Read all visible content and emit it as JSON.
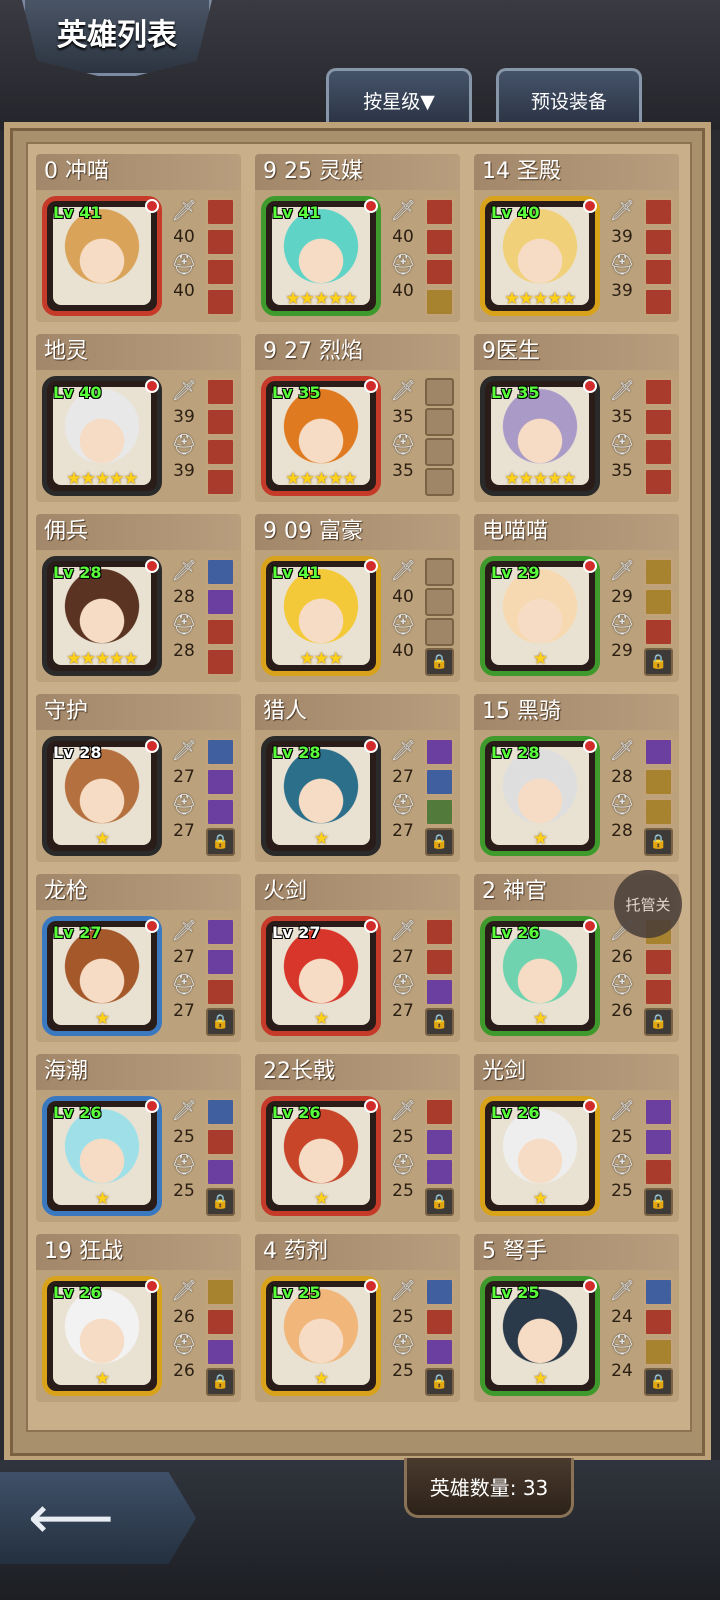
{
  "header": {
    "title": "英雄列表"
  },
  "tabs": [
    {
      "label": "按星级▼"
    },
    {
      "label": "预设装备"
    }
  ],
  "floating_button": {
    "label": "托管关"
  },
  "footer": {
    "hero_count_label": "英雄数量: 33",
    "back_icon": "arrow-left-icon"
  },
  "heroes": [
    {
      "name": "0 冲喵",
      "level": "Lv 41",
      "atk": "40",
      "def": "40",
      "stars": "",
      "border": "#c63a2a",
      "hair": "#d9a45a",
      "slots": [
        "red",
        "red",
        "red",
        "red"
      ]
    },
    {
      "name": "9 25 灵媒",
      "level": "Lv 41",
      "atk": "40",
      "def": "40",
      "stars": "★★★★★",
      "border": "#3f9a2e",
      "hair": "#5fd3c6",
      "slots": [
        "red",
        "red",
        "red",
        "gold"
      ]
    },
    {
      "name": "14 圣殿",
      "level": "Lv 40",
      "atk": "39",
      "def": "39",
      "stars": "★★★★★",
      "border": "#d9a21b",
      "hair": "#f1d07a",
      "slots": [
        "red",
        "red",
        "red",
        "red"
      ]
    },
    {
      "name": "地灵",
      "level": "Lv 40",
      "atk": "39",
      "def": "39",
      "stars": "★★★★★",
      "border": "#2a2a2a",
      "hair": "#e8e8e8",
      "slots": [
        "red",
        "red",
        "red",
        "red"
      ]
    },
    {
      "name": "9 27 烈焰",
      "level": "Lv 35",
      "atk": "35",
      "def": "35",
      "stars": "★★★★★",
      "border": "#c63a2a",
      "hair": "#e07a20",
      "slots": [
        "empty",
        "empty",
        "empty",
        "empty"
      ]
    },
    {
      "name": "9医生",
      "level": "Lv 35",
      "atk": "35",
      "def": "35",
      "stars": "★★★★★",
      "border": "#2a2a2a",
      "hair": "#a99ac8",
      "slots": [
        "red",
        "red",
        "red",
        "red"
      ]
    },
    {
      "name": "佣兵",
      "level": "Lv 28",
      "atk": "28",
      "def": "28",
      "stars": "★★★★★",
      "border": "#2a2a2a",
      "hair": "#5a3322",
      "slots": [
        "blue",
        "purple",
        "red",
        "red"
      ]
    },
    {
      "name": "9 09 富豪",
      "level": "Lv 41",
      "atk": "40",
      "def": "40",
      "stars": "★★★",
      "border": "#d9a21b",
      "hair": "#f3c93a",
      "slots": [
        "empty",
        "empty",
        "empty",
        "lock"
      ]
    },
    {
      "name": "电喵喵",
      "level": "Lv 29",
      "atk": "29",
      "def": "29",
      "stars": "★",
      "border": "#3f9a2e",
      "hair": "#f6d9b0",
      "slots": [
        "gold",
        "gold",
        "red",
        "lock"
      ]
    },
    {
      "name": "守护",
      "level": "Lv 28",
      "atk": "27",
      "def": "27",
      "stars": "★",
      "border": "#2a2a2a",
      "hair": "#b5703f",
      "slots": [
        "blue",
        "purple",
        "purple",
        "lock"
      ],
      "lv_white": true
    },
    {
      "name": "猎人",
      "level": "Lv 28",
      "atk": "27",
      "def": "27",
      "stars": "★",
      "border": "#2a2a2a",
      "hair": "#2c6f8a",
      "slots": [
        "purple",
        "blue",
        "green",
        "lock"
      ]
    },
    {
      "name": "15 黑骑",
      "level": "Lv 28",
      "atk": "28",
      "def": "28",
      "stars": "★",
      "border": "#3f9a2e",
      "hair": "#dedede",
      "slots": [
        "purple",
        "gold",
        "gold",
        "lock"
      ]
    },
    {
      "name": "龙枪",
      "level": "Lv 27",
      "atk": "27",
      "def": "27",
      "stars": "★",
      "border": "#3a78c0",
      "hair": "#a5582a",
      "slots": [
        "purple",
        "purple",
        "red",
        "lock"
      ]
    },
    {
      "name": "火剑",
      "level": "Lv 27",
      "atk": "27",
      "def": "27",
      "stars": "★",
      "border": "#c63a2a",
      "hair": "#d8362a",
      "slots": [
        "red",
        "red",
        "purple",
        "lock"
      ],
      "lv_white": true
    },
    {
      "name": "2 神官",
      "level": "Lv 26",
      "atk": "26",
      "def": "26",
      "stars": "★",
      "border": "#3f9a2e",
      "hair": "#6fd3b0",
      "slots": [
        "gold",
        "red",
        "red",
        "lock"
      ]
    },
    {
      "name": "海潮",
      "level": "Lv 26",
      "atk": "25",
      "def": "25",
      "stars": "★",
      "border": "#3a78c0",
      "hair": "#9fe0e8",
      "slots": [
        "blue",
        "red",
        "purple",
        "lock"
      ]
    },
    {
      "name": "22长戟",
      "level": "Lv 26",
      "atk": "25",
      "def": "25",
      "stars": "★",
      "border": "#c63a2a",
      "hair": "#c8452a",
      "slots": [
        "red",
        "purple",
        "purple",
        "lock"
      ]
    },
    {
      "name": "光剑",
      "level": "Lv 26",
      "atk": "25",
      "def": "25",
      "stars": "★",
      "border": "#d9a21b",
      "hair": "#eeeeee",
      "slots": [
        "purple",
        "purple",
        "red",
        "lock"
      ]
    },
    {
      "name": "19 狂战",
      "level": "Lv 26",
      "atk": "26",
      "def": "26",
      "stars": "★",
      "border": "#d9a21b",
      "hair": "#f2f2f2",
      "slots": [
        "gold",
        "red",
        "purple",
        "lock"
      ]
    },
    {
      "name": "4 药剂",
      "level": "Lv 25",
      "atk": "25",
      "def": "25",
      "stars": "★",
      "border": "#d9a21b",
      "hair": "#f0b67a",
      "slots": [
        "blue",
        "red",
        "purple",
        "lock"
      ]
    },
    {
      "name": "5 弩手",
      "level": "Lv 25",
      "atk": "24",
      "def": "24",
      "stars": "★",
      "border": "#3f9a2e",
      "hair": "#2a3a4a",
      "slots": [
        "blue",
        "red",
        "gold",
        "lock"
      ]
    }
  ]
}
